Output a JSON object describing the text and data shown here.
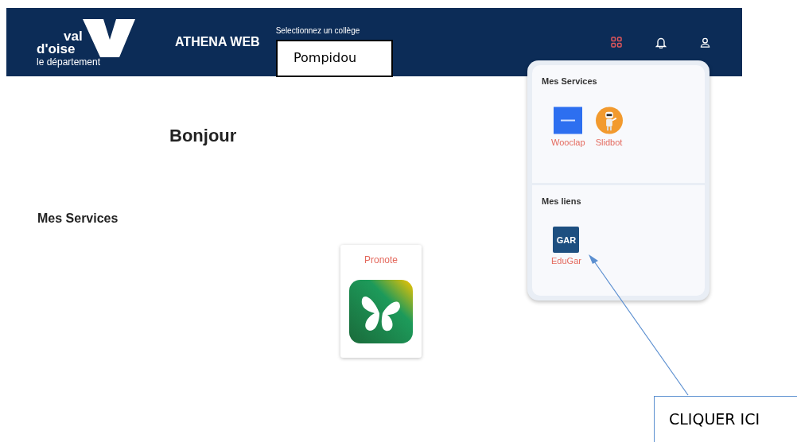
{
  "header": {
    "logo": {
      "line_1": "val",
      "line_2": "d'oise",
      "line_3": "le département"
    },
    "app_title": "ATHENA WEB",
    "college_select": {
      "label": "Selectionnez un collège",
      "value": "Pompidou"
    }
  },
  "greeting": "Bonjour",
  "section_title": "Mes Services",
  "services": [
    {
      "label": "Pronote",
      "kind": "pronote"
    }
  ],
  "popup": {
    "sections": [
      {
        "title": "Mes Services",
        "items": [
          {
            "label": "Wooclap",
            "kind": "wooclap"
          },
          {
            "label": "Slidbot",
            "kind": "slidbot"
          }
        ]
      },
      {
        "title": "Mes liens",
        "items": [
          {
            "label": "EduGar",
            "kind": "gar",
            "icon_text": "GAR"
          }
        ]
      }
    ]
  },
  "callout": {
    "text": "CLIQUER ICI"
  }
}
